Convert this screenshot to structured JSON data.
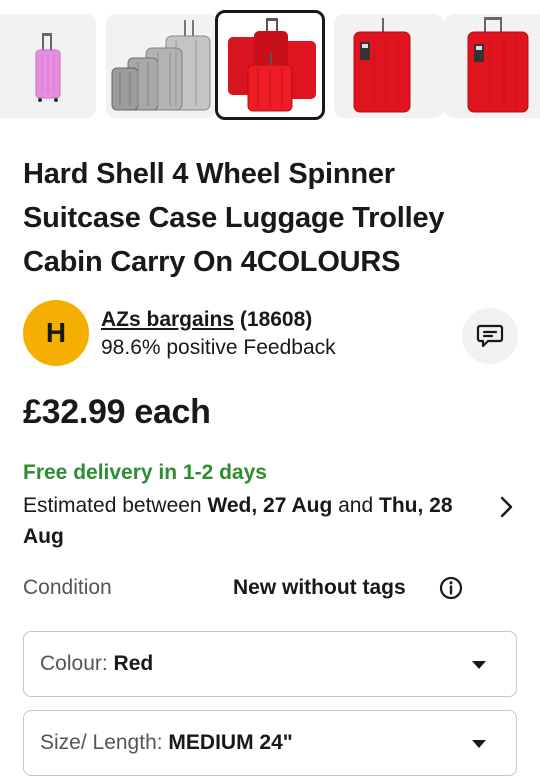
{
  "gallery": {
    "images": [
      {
        "icon": "pink-suitcase-image",
        "color": "#e98fe0"
      },
      {
        "icon": "silver-suitcase-set-image",
        "color": "#b8b8b8"
      },
      {
        "icon": "red-suitcase-set-image",
        "color": "#e0141e"
      },
      {
        "icon": "red-suitcase-image",
        "color": "#e0141e"
      },
      {
        "icon": "red-suitcase-image-2",
        "color": "#e0141e"
      }
    ],
    "selected_index": 2
  },
  "listing": {
    "title": "Hard Shell 4 Wheel Spinner Suitcase Case Luggage Trolley Cabin Carry On 4COLOURS",
    "price": "£32.99 each"
  },
  "seller": {
    "initial": "H",
    "name": "AZs bargains",
    "count": "(18608)",
    "feedback": "98.6% positive Feedback"
  },
  "delivery": {
    "headline": "Free delivery in 1-2 days",
    "est_prefix": "Estimated between ",
    "date_from": "Wed, 27 Aug",
    "est_and": " and ",
    "date_to": "Thu, 28 Aug"
  },
  "condition": {
    "label": "Condition",
    "value": "New without tags"
  },
  "selects": {
    "colour": {
      "label": "Colour: ",
      "value": "Red"
    },
    "size": {
      "label": "Size/ Length: ",
      "value": "MEDIUM 24\""
    }
  },
  "colors": {
    "accent_green": "#2e8c32",
    "avatar_yellow": "#f5af02",
    "text": "#191919"
  }
}
